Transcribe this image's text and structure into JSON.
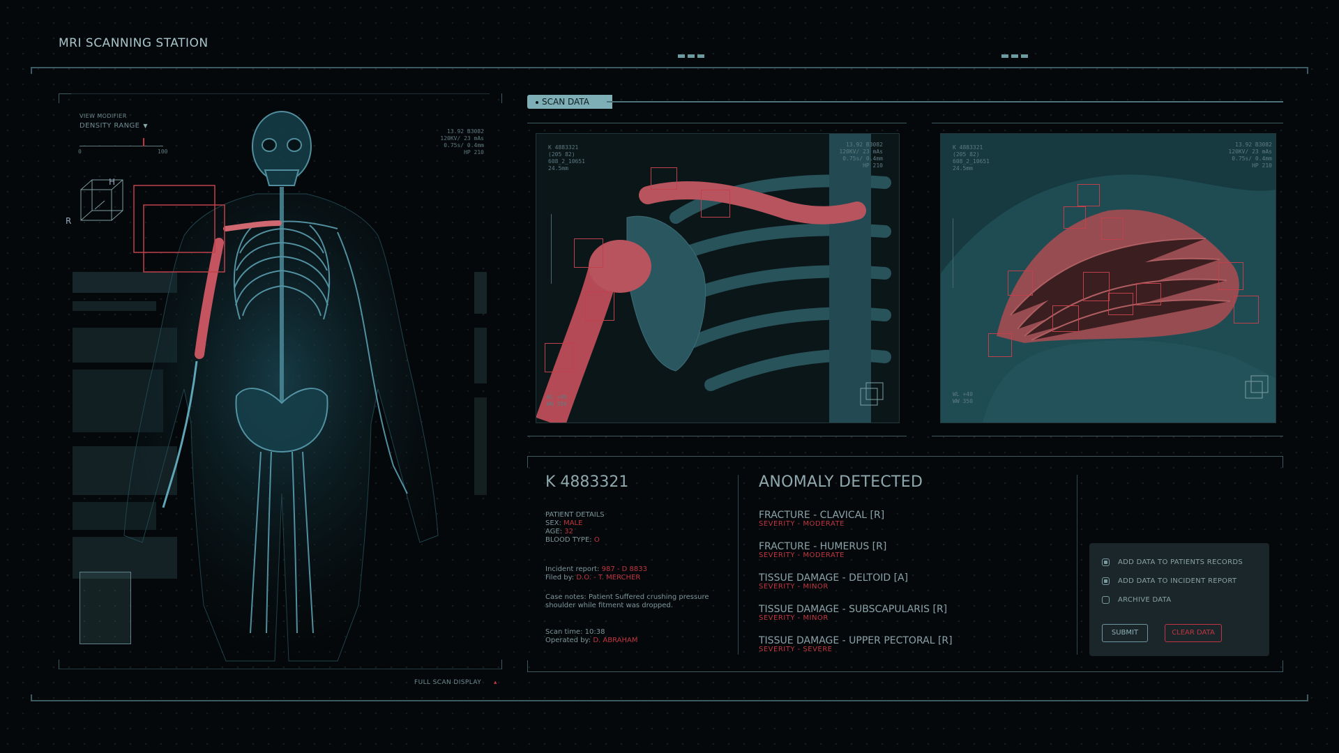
{
  "app": {
    "title": "MRI SCANNING STATION"
  },
  "view_modifier": {
    "label": "VIEW MODIFIER",
    "value": "DENSITY RANGE",
    "scale_min": "0",
    "scale_max": "100"
  },
  "scan_params": [
    "13.92 B3082",
    "120KV/ 23 mAs",
    "0.75s/ 0.4mm",
    "HP 210"
  ],
  "scan_ids": [
    "K 4883321",
    "(205 82)",
    "608_2_10651",
    "24.5mm"
  ],
  "orientation": {
    "h": "H",
    "r": "R"
  },
  "scan_data_tab": "SCAN DATA",
  "full_scan_label": "FULL SCAN DISPLAY",
  "window_readouts": {
    "left": [
      "WL +40",
      "WW 350"
    ],
    "right": [
      "WL +40",
      "WW 350"
    ]
  },
  "patient": {
    "id": "K 4883321",
    "details_label": "PATIENT DETAILS",
    "sex_label": "SEX:",
    "sex": "MALE",
    "age_label": "AGE:",
    "age": "32",
    "blood_label": "BLOOD TYPE:",
    "blood": "O",
    "incident_label": "Incident report:",
    "incident": "987 - D 8833",
    "filed_label": "Filed by:",
    "filed": "D.O. - T. MERCHER",
    "case_notes": "Case notes: Patient Suffered crushing pressure shoulder while fitment was dropped.",
    "scan_time_label": "Scan time:",
    "scan_time": "10:38",
    "operated_label": "Operated by:",
    "operated": "D. ABRAHAM"
  },
  "anomaly": {
    "title": "ANOMALY DETECTED",
    "items": [
      {
        "name": "FRACTURE - CLAVICAL [R]",
        "severity": "SEVERITY - MODERATE"
      },
      {
        "name": "FRACTURE - HUMERUS [R]",
        "severity": "SEVERITY - MODERATE"
      },
      {
        "name": "TISSUE DAMAGE - DELTOID [A]",
        "severity": "SEVERITY - MINOR"
      },
      {
        "name": "TISSUE DAMAGE - SUBSCAPULARIS [R]",
        "severity": "SEVERITY - MINOR"
      },
      {
        "name": "TISSUE DAMAGE - UPPER PECTORAL [R]",
        "severity": "SEVERITY - SEVERE"
      }
    ]
  },
  "actions": {
    "options": [
      {
        "label": "ADD DATA TO PATIENTS RECORDS",
        "checked": true
      },
      {
        "label": "ADD DATA TO INCIDENT REPORT",
        "checked": true
      },
      {
        "label": "ARCHIVE DATA",
        "checked": false
      }
    ],
    "submit": "SUBMIT",
    "clear": "CLEAR DATA"
  },
  "colors": {
    "accent": "#7eaeb6",
    "alert": "#c03642",
    "bone": "#3f6f7a"
  }
}
